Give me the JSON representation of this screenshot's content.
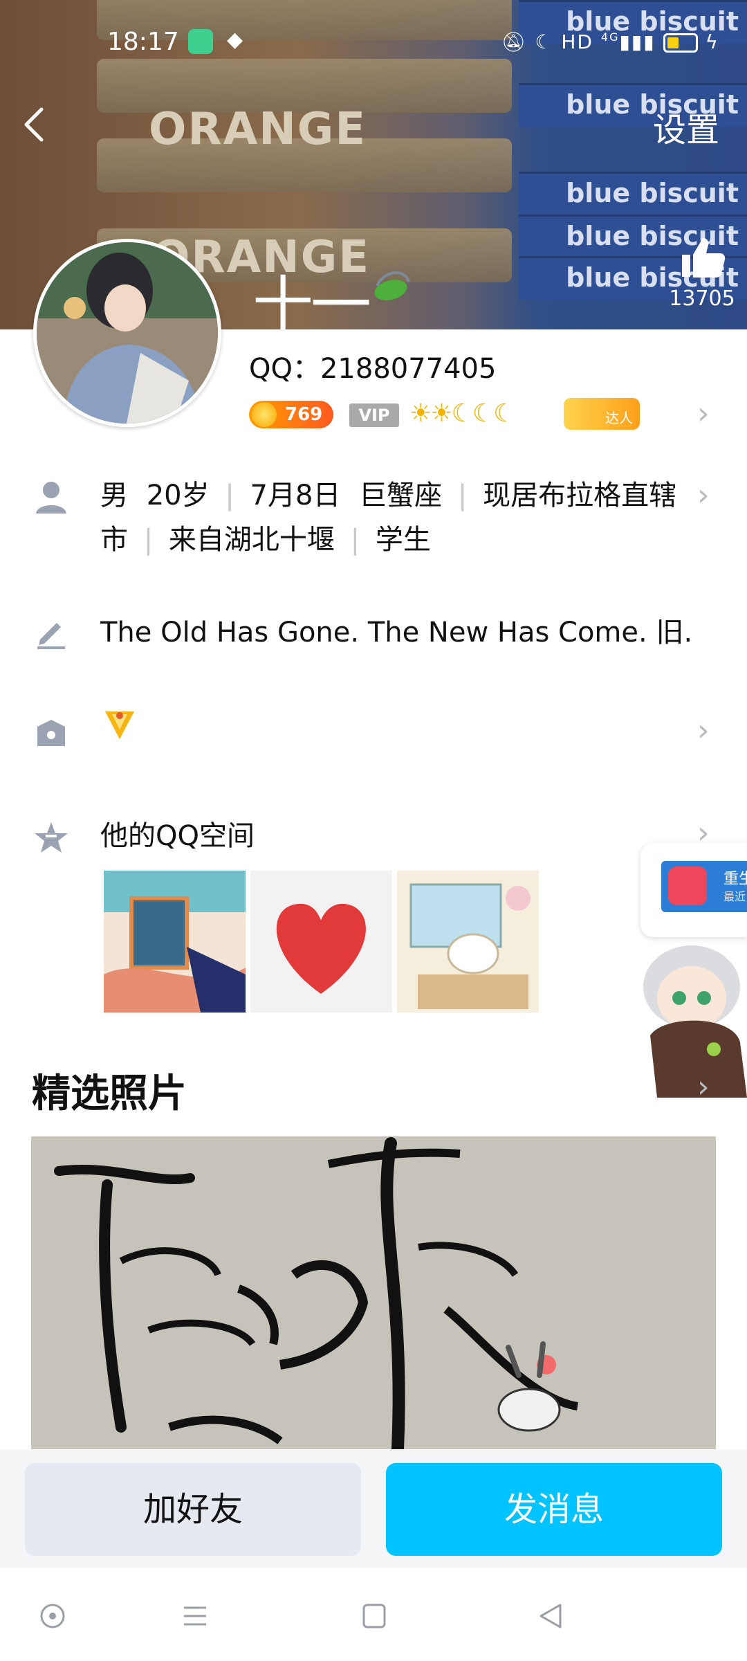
{
  "status_bar": {
    "time": "18:17",
    "network": "HD",
    "signal": "4G"
  },
  "header": {
    "back_label": "back",
    "settings_label": "设置",
    "nickname": "十一",
    "like_count": "13705",
    "banner_texts": [
      "ORANGE",
      "ORANGE",
      "blue biscuit",
      "blue biscuit",
      "blue biscuit",
      "blue biscuit",
      "blue biscuit"
    ]
  },
  "profile": {
    "qq": "QQ：2188077405",
    "coin_level": "769",
    "vip_label": "VIP",
    "daren_label": "达人",
    "info_line1": [
      "男",
      "20岁",
      "7月8日",
      "巨蟹座",
      "现居布拉格直辖"
    ],
    "info_line2": [
      "市",
      "来自湖北十堰",
      "学生"
    ],
    "signature": "The Old Has Gone. The New Has Come. 旧...",
    "qzone_label": "他的QQ空间"
  },
  "section": {
    "featured_photos": "精选照片"
  },
  "buttons": {
    "add_friend": "加好友",
    "send_message": "发消息"
  },
  "float_card": {
    "title": "重生",
    "subtitle": "最近"
  },
  "colors": {
    "accent": "#00c3ff",
    "add_btn": "#e7e9f1"
  }
}
